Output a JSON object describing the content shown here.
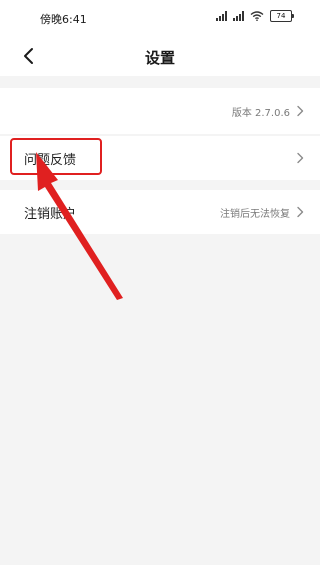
{
  "status": {
    "time": "傍晚6:41",
    "battery": "74"
  },
  "header": {
    "title": "设置"
  },
  "version_row": {
    "value": "版本 2.7.0.6"
  },
  "feedback_row": {
    "label": "问题反馈"
  },
  "cancel_row": {
    "label": "注销账户",
    "value": "注销后无法恢复"
  },
  "annotation": {
    "color": "#e02020"
  }
}
